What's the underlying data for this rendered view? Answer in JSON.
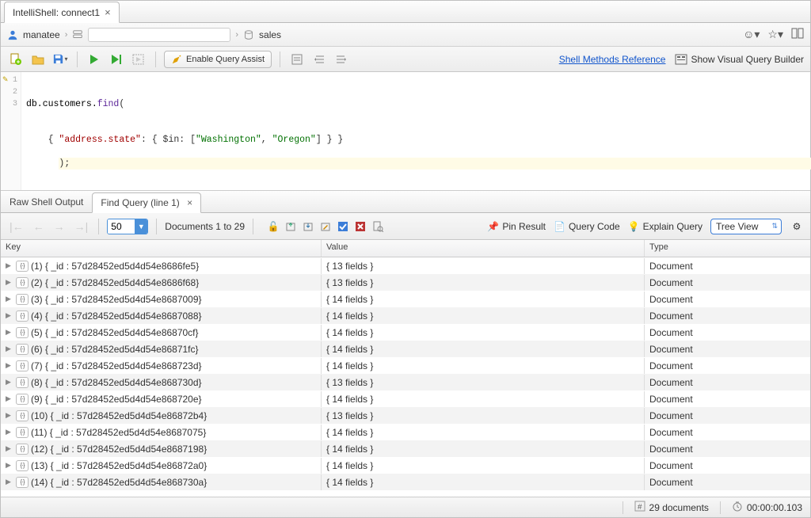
{
  "tab": {
    "title": "IntelliShell: connect1"
  },
  "breadcrumb": {
    "user": "manatee",
    "db": "sales"
  },
  "toolbar": {
    "enable_query_assist": "Enable Query Assist",
    "shell_methods_ref": "Shell Methods Reference",
    "show_vqb": "Show Visual Query Builder"
  },
  "editor": {
    "lines": {
      "l1_a": "db.customers.",
      "l1_b": "find",
      "l1_c": "(",
      "l2_a": "    { ",
      "l2_b": "\"address.state\"",
      "l2_c": ": { $in: [",
      "l2_d": "\"Washington\"",
      "l2_e": ", ",
      "l2_f": "\"Oregon\"",
      "l2_g": "] } }",
      "l3": ");"
    }
  },
  "result_tabs": {
    "raw": "Raw Shell Output",
    "find": "Find Query (line 1)"
  },
  "result_toolbar": {
    "page_size": "50",
    "doc_range": "Documents 1 to 29",
    "pin_result": "Pin Result",
    "query_code": "Query Code",
    "explain_query": "Explain Query",
    "view": "Tree View"
  },
  "grid": {
    "headers": {
      "key": "Key",
      "value": "Value",
      "type": "Type"
    },
    "rows": [
      {
        "idx": "(1)",
        "id": "57d28452ed5d4d54e8686fe5",
        "fields": 13
      },
      {
        "idx": "(2)",
        "id": "57d28452ed5d4d54e8686f68",
        "fields": 13
      },
      {
        "idx": "(3)",
        "id": "57d28452ed5d4d54e8687009",
        "fields": 14
      },
      {
        "idx": "(4)",
        "id": "57d28452ed5d4d54e8687088",
        "fields": 14
      },
      {
        "idx": "(5)",
        "id": "57d28452ed5d4d54e86870cf",
        "fields": 14
      },
      {
        "idx": "(6)",
        "id": "57d28452ed5d4d54e86871fc",
        "fields": 14
      },
      {
        "idx": "(7)",
        "id": "57d28452ed5d4d54e868723d",
        "fields": 14
      },
      {
        "idx": "(8)",
        "id": "57d28452ed5d4d54e868730d",
        "fields": 13
      },
      {
        "idx": "(9)",
        "id": "57d28452ed5d4d54e868720e",
        "fields": 14
      },
      {
        "idx": "(10)",
        "id": "57d28452ed5d4d54e86872b4",
        "fields": 13
      },
      {
        "idx": "(11)",
        "id": "57d28452ed5d4d54e8687075",
        "fields": 14
      },
      {
        "idx": "(12)",
        "id": "57d28452ed5d4d54e8687198",
        "fields": 14
      },
      {
        "idx": "(13)",
        "id": "57d28452ed5d4d54e86872a0",
        "fields": 14
      },
      {
        "idx": "(14)",
        "id": "57d28452ed5d4d54e868730a",
        "fields": 14
      }
    ],
    "type_label": "Document"
  },
  "status": {
    "doc_count": "29 documents",
    "elapsed": "00:00:00.103"
  },
  "strings": {
    "fields_brace": "fields }",
    "key_prefix": "{ _id : ",
    "key_suffix": "}",
    "val_prefix": "{ "
  }
}
